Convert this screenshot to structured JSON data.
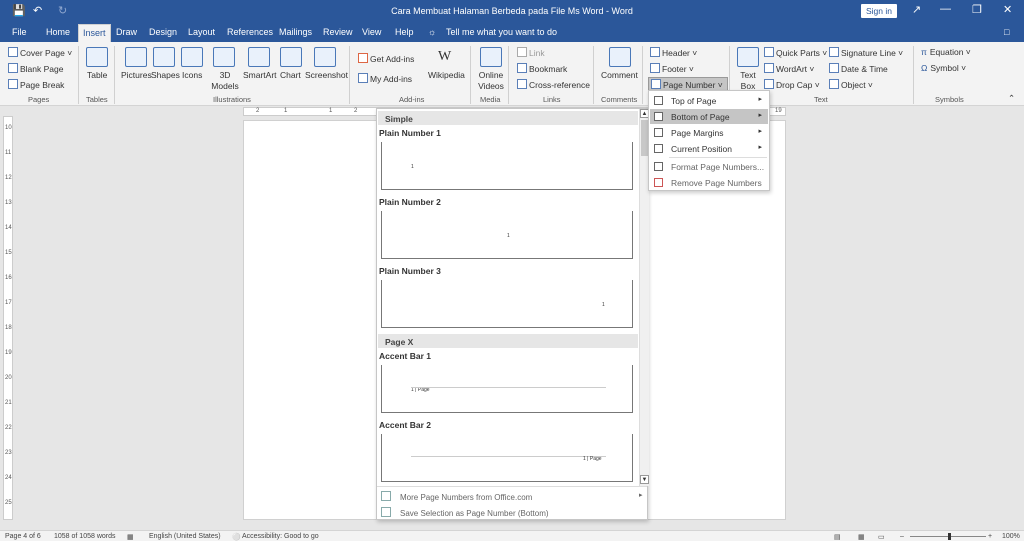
{
  "window": {
    "title": "Cara Membuat Halaman Berbeda pada File Ms Word  -  Word",
    "signin": "Sign in",
    "qat": {
      "save": "💾",
      "undo": "↶",
      "redo": "↻"
    },
    "controls": {
      "ribbon_display": "↗",
      "minimize": "—",
      "restore": "❐",
      "close": "✕"
    }
  },
  "tabs": [
    "File",
    "Home",
    "Insert",
    "Draw",
    "Design",
    "Layout",
    "References",
    "Mailings",
    "Review",
    "View",
    "Help"
  ],
  "tellme": "Tell me what you want to do",
  "ribbon": {
    "pages": {
      "group": "Pages",
      "cover": "Cover Page ˅",
      "blank": "Blank Page",
      "break": "Page Break"
    },
    "tables": {
      "group": "Tables",
      "table": "Table"
    },
    "illustrations": {
      "group": "Illustrations",
      "pictures": "Pictures",
      "shapes": "Shapes",
      "icons": "Icons",
      "models": "3D Models",
      "smartart": "SmartArt",
      "chart": "Chart",
      "screenshot": "Screenshot"
    },
    "addins": {
      "group": "Add-ins",
      "get": "Get Add-ins",
      "my": "My Add-ins",
      "wikipedia": "Wikipedia"
    },
    "media": {
      "group": "Media",
      "online": "Online Videos"
    },
    "links": {
      "group": "Links",
      "link": "Link",
      "bookmark": "Bookmark",
      "cross": "Cross-reference"
    },
    "comments": {
      "group": "Comments",
      "comment": "Comment"
    },
    "hf": {
      "header": "Header ˅",
      "footer": "Footer ˅",
      "pagenum": "Page Number ˅"
    },
    "text": {
      "group": "Text",
      "textbox": "Text Box",
      "quickparts": "Quick Parts ˅",
      "wordart": "WordArt ˅",
      "dropcap": "Drop Cap ˅",
      "sigline": "Signature Line ˅",
      "datetime": "Date & Time",
      "object": "Object ˅"
    },
    "symbols": {
      "group": "Symbols",
      "equation": "Equation ˅",
      "symbol": "Symbol ˅"
    }
  },
  "gallery": {
    "sections": [
      "Simple",
      "Page X"
    ],
    "items": [
      "Plain Number 1",
      "Plain Number 2",
      "Plain Number 3",
      "Accent Bar 1",
      "Accent Bar 2"
    ],
    "sample_num": "1",
    "accent_sample": "1 | Page",
    "more": "More Page Numbers from Office.com",
    "save": "Save Selection as Page Number (Bottom)"
  },
  "submenu": {
    "items": [
      "Top of Page",
      "Bottom of Page",
      "Page Margins",
      "Current Position",
      "Format Page Numbers...",
      "Remove Page Numbers"
    ],
    "highlighted": "Bottom of Page"
  },
  "status": {
    "page": "Page 4 of 6",
    "words": "1058 of 1058 words",
    "language": "English (United States)",
    "accessibility": "Accessibility: Good to go",
    "zoom": "100%"
  },
  "ruler": {
    "vertical": [
      "10",
      "11",
      "12",
      "13",
      "14",
      "15",
      "16",
      "17",
      "18",
      "19",
      "20",
      "21",
      "22",
      "23",
      "24",
      "25"
    ],
    "horizontal": [
      "2",
      "1",
      "1",
      "2",
      "19"
    ]
  }
}
